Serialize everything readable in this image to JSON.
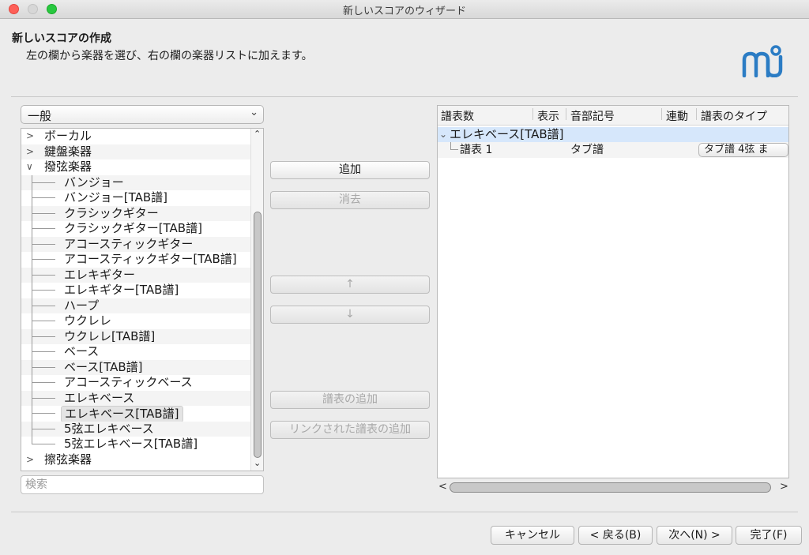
{
  "window": {
    "title": "新しいスコアのウィザード"
  },
  "header": {
    "title": "新しいスコアの作成",
    "description": "左の欄から楽器を選び、右の欄の楽器リストに加えます。"
  },
  "category_select": {
    "value": "一般"
  },
  "tree": {
    "groups": [
      {
        "label": "ボーカル",
        "expanded": false
      },
      {
        "label": "鍵盤楽器",
        "expanded": false
      },
      {
        "label": "撥弦楽器",
        "expanded": true
      },
      {
        "label": "擦弦楽器",
        "expanded": false
      }
    ],
    "items": [
      "バンジョー",
      "バンジョー[TAB譜]",
      "クラシックギター",
      "クラシックギター[TAB譜]",
      "アコースティックギター",
      "アコースティックギター[TAB譜]",
      "エレキギター",
      "エレキギター[TAB譜]",
      "ハープ",
      "ウクレレ",
      "ウクレレ[TAB譜]",
      "ベース",
      "ベース[TAB譜]",
      "アコースティックベース",
      "エレキベース",
      "エレキベース[TAB譜]",
      "5弦エレキベース",
      "5弦エレキベース[TAB譜]"
    ],
    "selected": "エレキベース[TAB譜]"
  },
  "search": {
    "placeholder": "検索"
  },
  "middle_buttons": {
    "add": "追加",
    "remove": "消去",
    "up": "↑",
    "down": "↓",
    "add_staff": "譜表の追加",
    "add_linked_staff": "リンクされた譜表の追加"
  },
  "score_table": {
    "columns": [
      "譜表数",
      "表示",
      "音部記号",
      "連動",
      "譜表のタイプ"
    ],
    "instrument": "エレキベース[TAB譜]",
    "staff": {
      "name": "譜表 1",
      "clef": "タブ譜",
      "type": "タブ譜 4弦 ま"
    }
  },
  "footer": {
    "cancel": "キャンセル",
    "back": "< 戻る(B)",
    "next": "次へ(N) >",
    "finish": "完了(F)"
  }
}
